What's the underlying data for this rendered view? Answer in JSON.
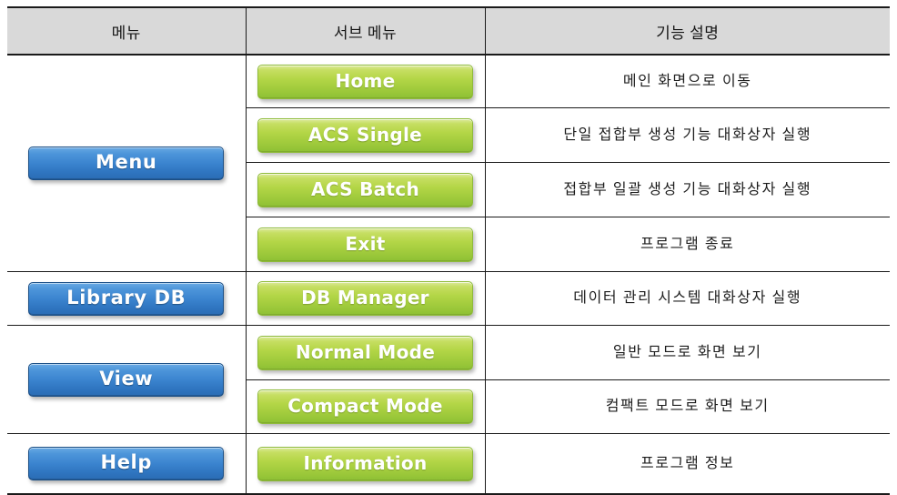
{
  "table": {
    "headers": {
      "menu": "메뉴",
      "sub_menu": "서브 메뉴",
      "description": "기능 설명"
    },
    "groups": [
      {
        "menu_label": "Menu",
        "rows": [
          {
            "sub_menu": "Home",
            "description": "메인 화면으로 이동"
          },
          {
            "sub_menu": "ACS Single",
            "description": "단일 접합부 생성 기능 대화상자 실행"
          },
          {
            "sub_menu": "ACS Batch",
            "description": "접합부 일괄 생성 기능 대화상자 실행"
          },
          {
            "sub_menu": "Exit",
            "description": "프로그램 종료"
          }
        ]
      },
      {
        "menu_label": "Library DB",
        "rows": [
          {
            "sub_menu": "DB Manager",
            "description": "데이터 관리 시스템 대화상자 실행"
          }
        ]
      },
      {
        "menu_label": "View",
        "rows": [
          {
            "sub_menu": "Normal Mode",
            "description": "일반 모드로 화면 보기"
          },
          {
            "sub_menu": "Compact Mode",
            "description": "컴팩트 모드로 화면 보기"
          }
        ]
      },
      {
        "menu_label": "Help",
        "rows": [
          {
            "sub_menu": "Information",
            "description": "프로그램 정보"
          }
        ]
      }
    ]
  },
  "colors": {
    "header_background": "#d9d9d9",
    "border": "#1a1a1a",
    "blue_button_top": "#6aaae4",
    "blue_button_bottom": "#2a6cb4",
    "blue_button_border": "#1b4f86",
    "green_button_top": "#dcea9b",
    "green_button_bottom": "#8ec034",
    "green_button_border": "#8fbb3a",
    "button_text": "#ffffff",
    "body_text": "#1d1d1d"
  }
}
